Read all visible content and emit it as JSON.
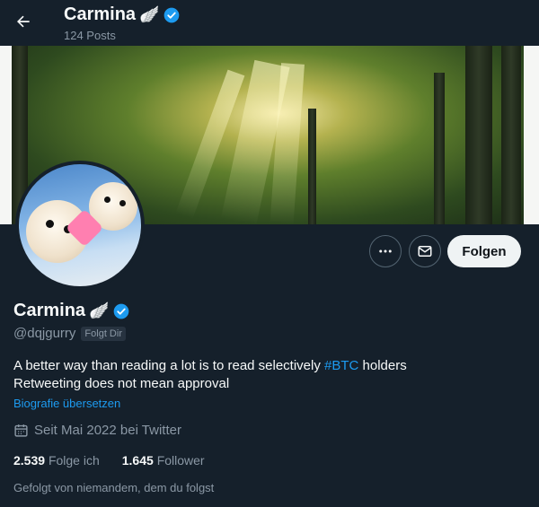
{
  "header": {
    "title": "Carmina",
    "title_emoji": "🪽",
    "posts_count": "124 Posts"
  },
  "profile": {
    "display_name": "Carmina",
    "name_emoji": "🪽",
    "handle": "@dqjgurry",
    "follows_you_badge": "Folgt Dir",
    "bio_line1_text": "A better way than reading a lot is to read selectively ",
    "bio_hashtag": "#BTC",
    "bio_line1_end": " holders",
    "bio_line2": "Retweeting does not mean approval",
    "translate_link": "Biografie übersetzen",
    "joined": "Seit Mai 2022 bei Twitter",
    "following_count": "2.539",
    "following_label": "Folge ich",
    "followers_count": "1.645",
    "followers_label": "Follower",
    "mutuals_text": "Gefolgt von niemandem, dem du folgst"
  },
  "actions": {
    "follow_label": "Folgen"
  },
  "icons": {
    "back": "arrow-left-icon",
    "verified": "verified-badge-icon",
    "more": "more-dots-icon",
    "message": "envelope-icon",
    "calendar": "calendar-icon"
  },
  "colors": {
    "background": "#15202b",
    "accent": "#1d9bf0",
    "secondary_text": "#8b98a5",
    "follow_button": "#eff3f4"
  }
}
